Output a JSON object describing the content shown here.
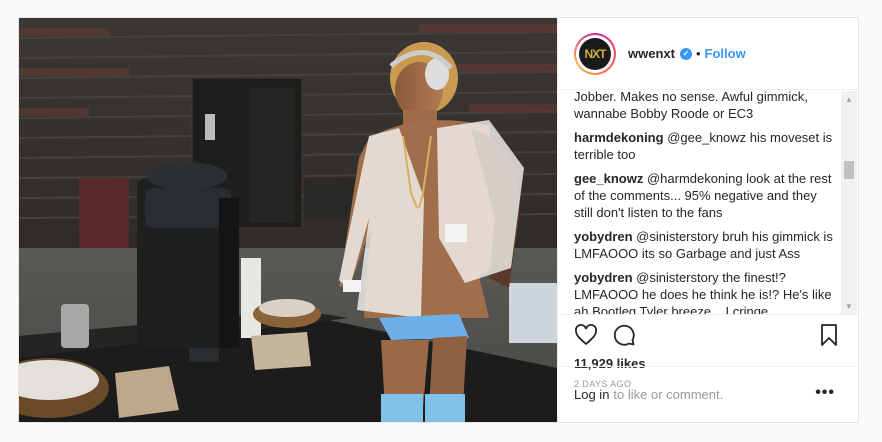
{
  "post": {
    "username": "wwenxt",
    "avatar_text": "NXT",
    "verified_glyph": "✓",
    "separator": "•",
    "follow_label": "Follow",
    "comments": [
      {
        "user": "",
        "text": "Jobber. Makes no sense. Awful gimmick, wannabe Bobby Roode or EC3"
      },
      {
        "user": "harmdekoning",
        "text": "@gee_knowz his moveset is terrible too"
      },
      {
        "user": "gee_knowz",
        "text": "@harmdekoning look at the rest of the comments... 95% negative and they still don't listen to the fans"
      },
      {
        "user": "yobydren",
        "text": "@sinisterstory bruh his gimmick is LMFAOOO its so Garbage and just Ass"
      },
      {
        "user": "yobydren",
        "text": "@sinisterstory the finest!? LMFAOOO he does he think he is!? He's like ah Bootleg Tyler breeze... I cringe"
      }
    ],
    "likes": "11,929 likes",
    "date": "2 DAYS AGO",
    "login_link": "Log in",
    "login_rest": "to like or comment.",
    "more_label": "•••"
  },
  "icons": [
    "heart-icon",
    "comment-icon",
    "bookmark-icon",
    "more-icon",
    "verified-badge-icon"
  ],
  "colors": {
    "link": "#3897f0",
    "text": "#262626",
    "muted": "#999999",
    "border": "#efefef"
  }
}
